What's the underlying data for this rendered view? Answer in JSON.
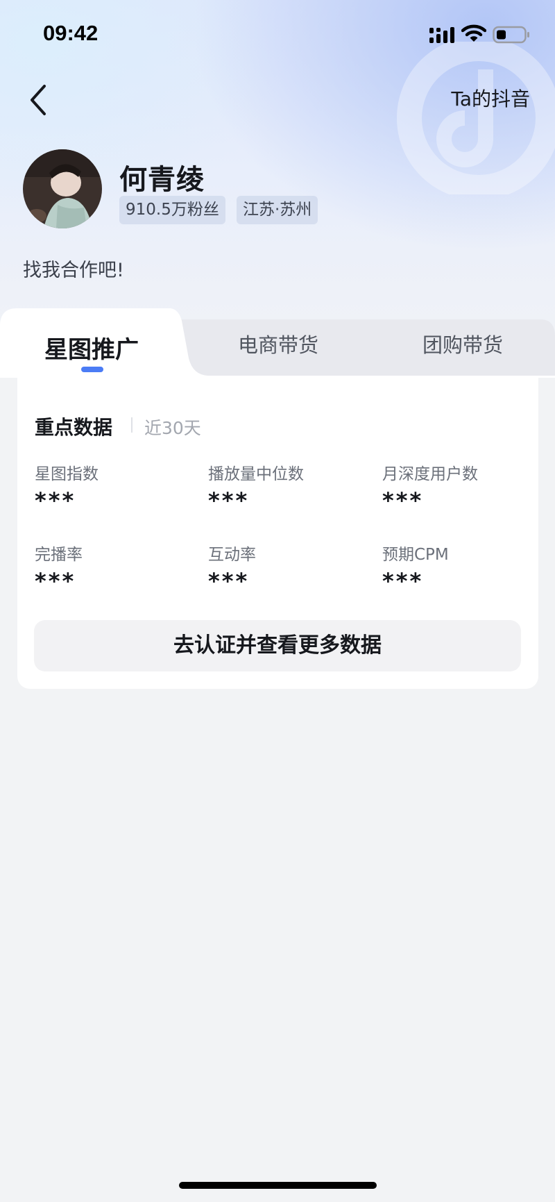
{
  "status_bar": {
    "time": "09:42",
    "icons": [
      "signal-icon",
      "wifi-icon",
      "battery-icon"
    ]
  },
  "nav": {
    "back_icon": "chevron-left-icon",
    "tiktok_link": "Ta的抖音"
  },
  "profile": {
    "name": "何青绫",
    "followers": "910.5万粉丝",
    "location": "江苏·苏州",
    "bio": "找我合作吧!"
  },
  "tabs": [
    {
      "label": "星图推广",
      "active": true
    },
    {
      "label": "电商带货",
      "active": false
    },
    {
      "label": "团购带货",
      "active": false
    }
  ],
  "key_data": {
    "title": "重点数据",
    "period": "近30天",
    "metrics": [
      {
        "label": "星图指数",
        "value": "***"
      },
      {
        "label": "播放量中位数",
        "value": "***"
      },
      {
        "label": "月深度用户数",
        "value": "***"
      },
      {
        "label": "完播率",
        "value": "***"
      },
      {
        "label": "互动率",
        "value": "***"
      },
      {
        "label": "预期CPM",
        "value": "***"
      }
    ],
    "cta": "去认证并查看更多数据"
  },
  "colors": {
    "accent": "#4b7cf5",
    "background": "#f2f3f5",
    "card": "#ffffff",
    "text_primary": "#16181d",
    "text_secondary": "#6b707a"
  }
}
